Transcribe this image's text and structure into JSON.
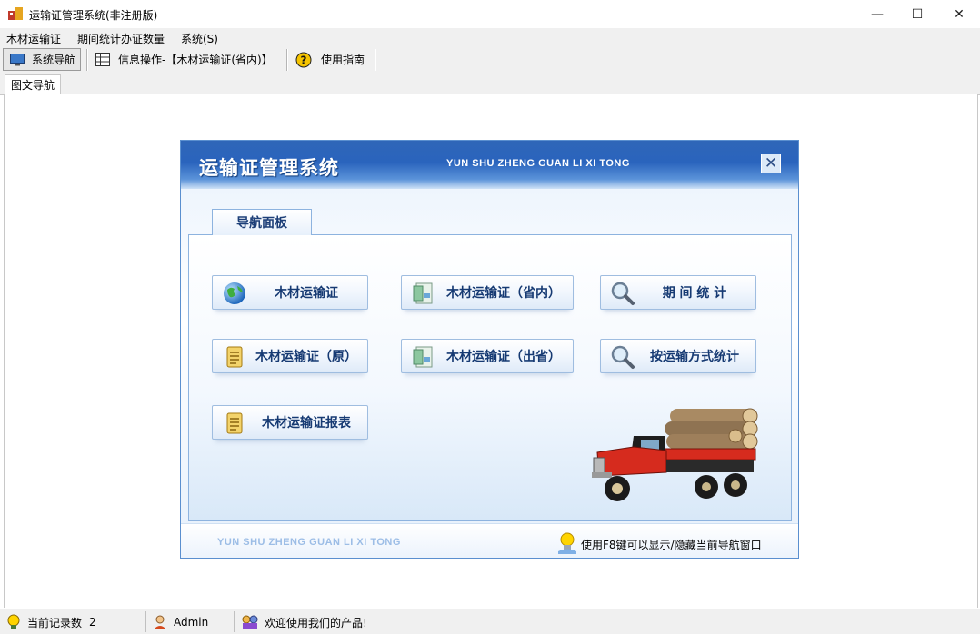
{
  "window": {
    "title": "运输证管理系统(非注册版)",
    "minimize": "—",
    "maximize": "☐",
    "close": "✕"
  },
  "menu": [
    "木材运输证",
    "期间统计办证数量",
    "系统(S)"
  ],
  "toolbar": {
    "items": [
      {
        "label": "系统导航",
        "icon": "monitor-icon"
      },
      {
        "label": "信息操作-【木材运输证(省内)】",
        "icon": "grid-icon"
      },
      {
        "label": "使用指南",
        "icon": "help-icon"
      }
    ]
  },
  "tabs": [
    "图文导航"
  ],
  "dialog": {
    "title": "运输证管理系统",
    "subtitle": "YUN SHU ZHENG GUAN LI XI TONG",
    "close": "✕",
    "panel_tab": "导航面板",
    "buttons": [
      {
        "label": "木材运输证",
        "icon": "globe-icon"
      },
      {
        "label": "木材运输证（省内）",
        "icon": "document-icon"
      },
      {
        "label": "期 间 统 计",
        "icon": "magnifier-icon"
      },
      {
        "label": "木材运输证（原）",
        "icon": "scroll-icon"
      },
      {
        "label": "木材运输证（出省）",
        "icon": "document-icon"
      },
      {
        "label": "按运输方式统计",
        "icon": "magnifier-icon"
      },
      {
        "label": "木材运输证报表",
        "icon": "scroll-icon"
      }
    ],
    "footer_subtitle": "YUN SHU ZHENG GUAN LI XI TONG",
    "footer_tip": "使用F8键可以显示/隐藏当前导航窗口"
  },
  "status": {
    "record_label": "当前记录数",
    "record_count": "2",
    "user": "Admin",
    "message": "欢迎使用我们的产品!"
  },
  "colors": {
    "dialog_header": "#2a64bd",
    "button_text": "#163a73",
    "panel_border": "#8db3df"
  }
}
